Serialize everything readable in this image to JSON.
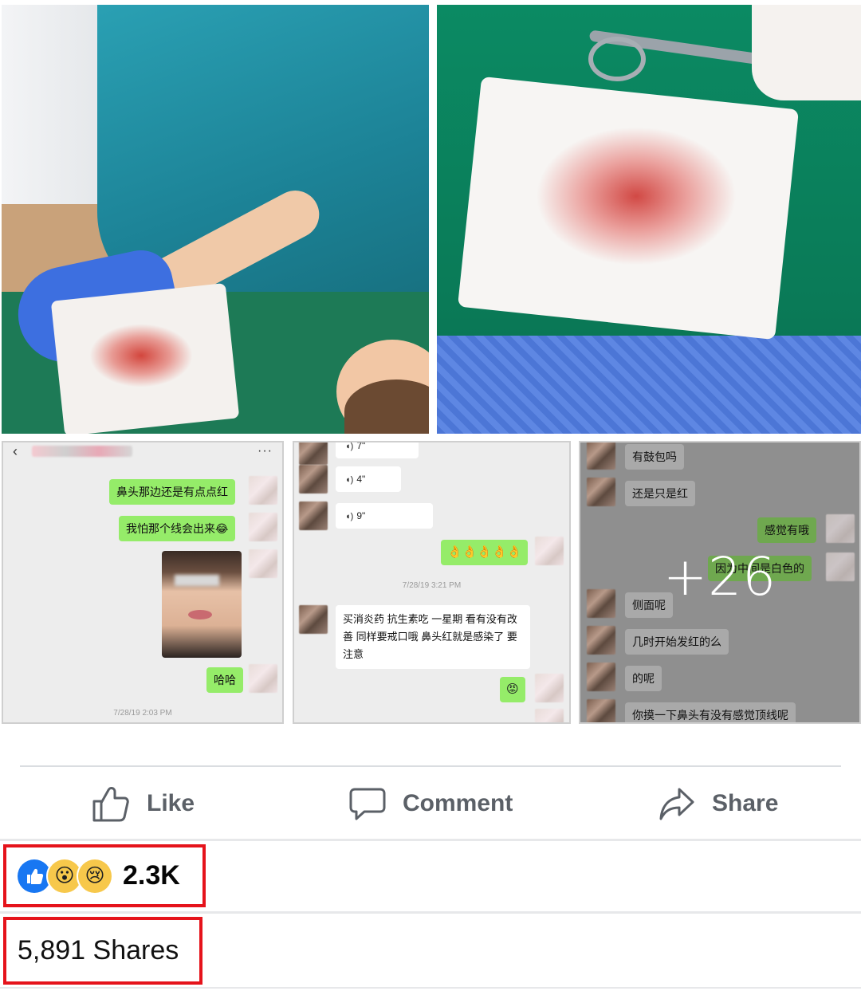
{
  "gallery": {
    "more_count": "+26"
  },
  "chat1": {
    "msg1": "鼻头那边还是有点点红",
    "msg2": "我怕那个线会出来😂",
    "msg3": "哈哈",
    "timestamp": "7/28/19 2:03 PM"
  },
  "chat2": {
    "voice1": "7\"",
    "voice2": "4\"",
    "voice3": "9\"",
    "emoji_row": "👌👌👌👌👌",
    "timestamp": "7/28/19 3:21 PM",
    "advice": "买消炎药 抗生素吃 一星期 看有没有改善 同样要戒口哦 鼻头红就是感染了 要注意",
    "emoji_reply": "😡"
  },
  "chat3": {
    "msg1": "有鼓包吗",
    "msg2": "还是只是红",
    "msg3": "感觉有哦",
    "msg4": "因为中间是白色的",
    "msg5": "侧面呢",
    "msg6": "几时开始发红的么",
    "msg7": "的呢",
    "msg8": "你摸一下鼻头有没有感觉顶线呢"
  },
  "actions": {
    "like": "Like",
    "comment": "Comment",
    "share": "Share"
  },
  "stats": {
    "reactions_count": "2.3K",
    "shares": "5,891 Shares"
  },
  "colors": {
    "highlight_border": "#e5131b",
    "like_blue": "#1877f2",
    "action_text": "#5b6067"
  },
  "icons": {
    "like": "thumbs-up-icon",
    "comment": "speech-bubble-icon",
    "share": "share-arrow-icon"
  }
}
